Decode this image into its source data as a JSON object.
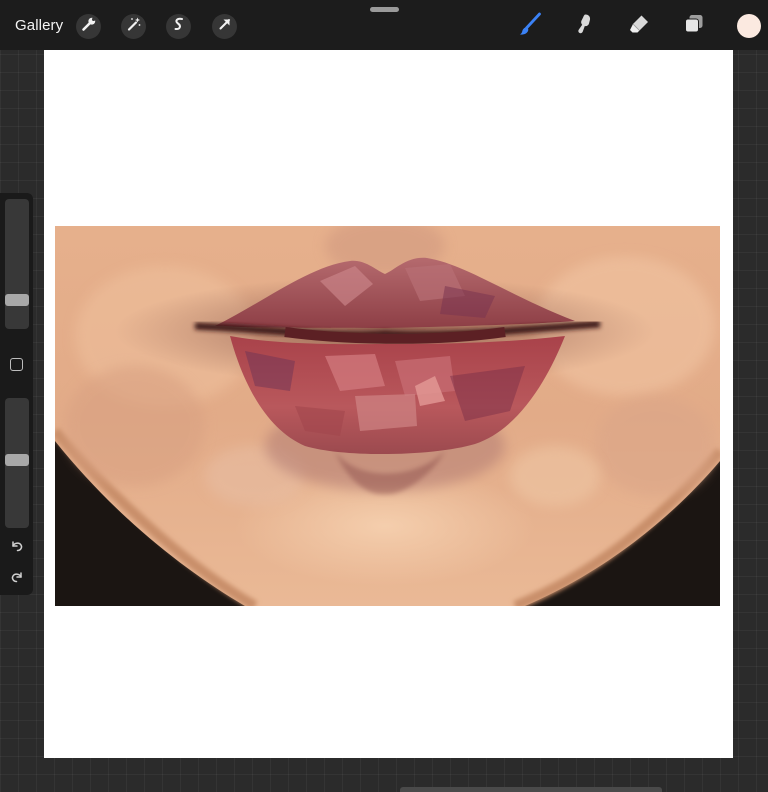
{
  "topbar": {
    "gallery_label": "Gallery",
    "left_tools": [
      "wrench-icon",
      "magic-wand-icon",
      "selection-icon",
      "transform-arrow-icon"
    ],
    "right_tools": [
      "brush-icon",
      "smudge-icon",
      "eraser-icon",
      "layers-icon"
    ],
    "active_tool": "brush",
    "active_tool_color": "#3b82f6",
    "current_color": "#fbe9e0"
  },
  "sidebar": {
    "brush_size_level": 0.22,
    "opacity_level": 0.52,
    "controls": [
      "brush-size-slider",
      "modify-button",
      "opacity-slider",
      "undo-icon",
      "redo-icon"
    ]
  },
  "canvas": {
    "background": "#ffffff",
    "artwork": "painted-lips-artwork"
  }
}
